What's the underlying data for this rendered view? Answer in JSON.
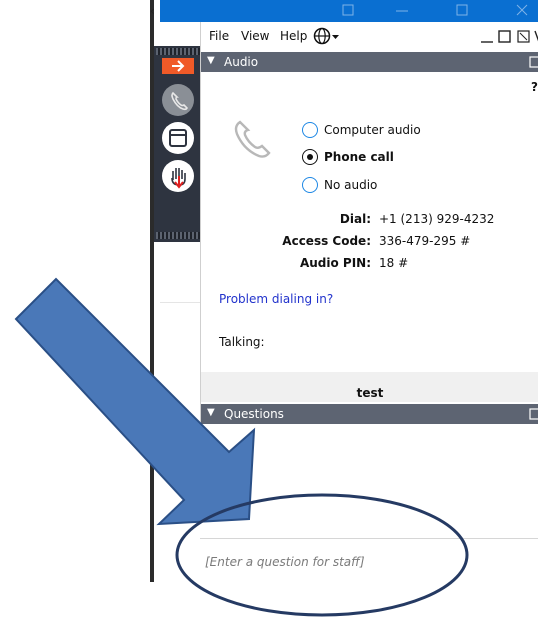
{
  "menu": {
    "file": "File",
    "view": "View",
    "help": "Help"
  },
  "audio": {
    "header": "Audio",
    "help_glyph": "?",
    "options": [
      "Computer audio",
      "Phone call",
      "No audio"
    ],
    "selected_option": "Phone call",
    "dial_label": "Dial:",
    "dial_value": "+1 (213) 929-4232",
    "access_label": "Access Code:",
    "access_value": "336-479-295 #",
    "pin_label": "Audio PIN:",
    "pin_value": "18 #",
    "problem_link": "Problem dialing in?",
    "talking_label": "Talking:",
    "current_speaker": "test"
  },
  "questions": {
    "header": "Questions",
    "input_placeholder": "[Enter a question for staff]"
  },
  "colors": {
    "accent_blue": "#1e88e5",
    "section_header": "#5d6472",
    "toolbar": "#2e3440",
    "orange": "#f05a28",
    "annotation_arrow": "#4a78b8",
    "annotation_ellipse": "#253a63"
  }
}
